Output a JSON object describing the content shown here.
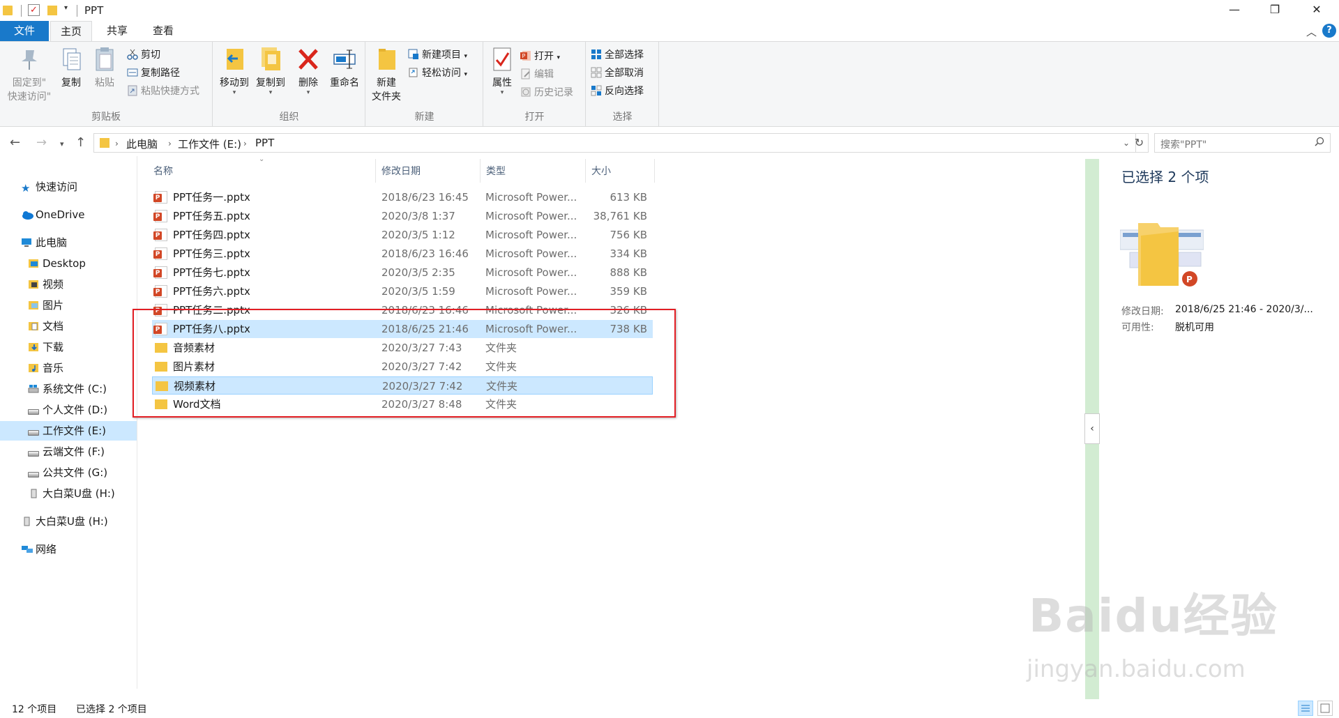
{
  "window": {
    "title": "PPT",
    "minimize": "—",
    "maximize": "❐",
    "close": "✕"
  },
  "tabs": {
    "file": "文件",
    "home": "主页",
    "share": "共享",
    "view": "查看"
  },
  "ribbon": {
    "clipboard": {
      "label": "剪贴板",
      "pin_line1": "固定到\"",
      "pin_line2": "快速访问\"",
      "copy": "复制",
      "paste": "粘贴",
      "cut": "剪切",
      "copy_path": "复制路径",
      "paste_shortcut": "粘贴快捷方式"
    },
    "organize": {
      "label": "组织",
      "move_to": "移动到",
      "copy_to": "复制到",
      "delete": "删除",
      "rename": "重命名"
    },
    "new": {
      "label": "新建",
      "new_folder_line1": "新建",
      "new_folder_line2": "文件夹",
      "new_item": "新建项目",
      "easy_access": "轻松访问"
    },
    "open": {
      "label": "打开",
      "properties": "属性",
      "open": "打开",
      "edit": "编辑",
      "history": "历史记录"
    },
    "select": {
      "label": "选择",
      "select_all": "全部选择",
      "select_none": "全部取消",
      "invert": "反向选择"
    }
  },
  "address": {
    "crumbs": [
      "此电脑",
      "工作文件 (E:)",
      "PPT"
    ],
    "search_placeholder": "搜索\"PPT\""
  },
  "sidebar": {
    "items": [
      {
        "label": "快速访问"
      },
      {
        "label": "OneDrive"
      },
      {
        "label": "此电脑"
      },
      {
        "label": "Desktop"
      },
      {
        "label": "视频"
      },
      {
        "label": "图片"
      },
      {
        "label": "文档"
      },
      {
        "label": "下载"
      },
      {
        "label": "音乐"
      },
      {
        "label": "系统文件 (C:)"
      },
      {
        "label": "个人文件 (D:)"
      },
      {
        "label": "工作文件 (E:)"
      },
      {
        "label": "云端文件 (F:)"
      },
      {
        "label": "公共文件 (G:)"
      },
      {
        "label": "大白菜U盘 (H:)"
      },
      {
        "label": "大白菜U盘 (H:)"
      },
      {
        "label": "网络"
      }
    ]
  },
  "columns": {
    "name": "名称",
    "date": "修改日期",
    "type": "类型",
    "size": "大小"
  },
  "files": [
    {
      "name": "PPT任务一.pptx",
      "date": "2018/6/23 16:45",
      "type": "Microsoft Power...",
      "size": "613 KB"
    },
    {
      "name": "PPT任务五.pptx",
      "date": "2020/3/8 1:37",
      "type": "Microsoft Power...",
      "size": "38,761 KB"
    },
    {
      "name": "PPT任务四.pptx",
      "date": "2020/3/5 1:12",
      "type": "Microsoft Power...",
      "size": "756 KB"
    },
    {
      "name": "PPT任务三.pptx",
      "date": "2018/6/23 16:46",
      "type": "Microsoft Power...",
      "size": "334 KB"
    },
    {
      "name": "PPT任务七.pptx",
      "date": "2020/3/5 2:35",
      "type": "Microsoft Power...",
      "size": "888 KB"
    },
    {
      "name": "PPT任务六.pptx",
      "date": "2020/3/5 1:59",
      "type": "Microsoft Power...",
      "size": "359 KB"
    },
    {
      "name": "PPT任务二.pptx",
      "date": "2018/6/23 16:46",
      "type": "Microsoft Power...",
      "size": "326 KB"
    },
    {
      "name": "PPT任务八.pptx",
      "date": "2018/6/25 21:46",
      "type": "Microsoft Power...",
      "size": "738 KB"
    },
    {
      "name": "音频素材",
      "date": "2020/3/27 7:43",
      "type": "文件夹",
      "size": ""
    },
    {
      "name": "图片素材",
      "date": "2020/3/27 7:42",
      "type": "文件夹",
      "size": ""
    },
    {
      "name": "视频素材",
      "date": "2020/3/27 7:42",
      "type": "文件夹",
      "size": ""
    },
    {
      "name": "Word文档",
      "date": "2020/3/27 8:48",
      "type": "文件夹",
      "size": ""
    }
  ],
  "details": {
    "title": "已选择 2 个项",
    "modified_label": "修改日期:",
    "modified_value": "2018/6/25 21:46 - 2020/3/...",
    "availability_label": "可用性:",
    "availability_value": "脱机可用"
  },
  "status": {
    "count": "12 个项目",
    "selected": "已选择 2 个项目"
  },
  "watermark": {
    "main": "Baidu经验",
    "sub": "jingyan.baidu.com"
  },
  "colors": {
    "accent": "#1979ca",
    "selection": "#cce8ff",
    "highlight_box": "#e31e24"
  }
}
